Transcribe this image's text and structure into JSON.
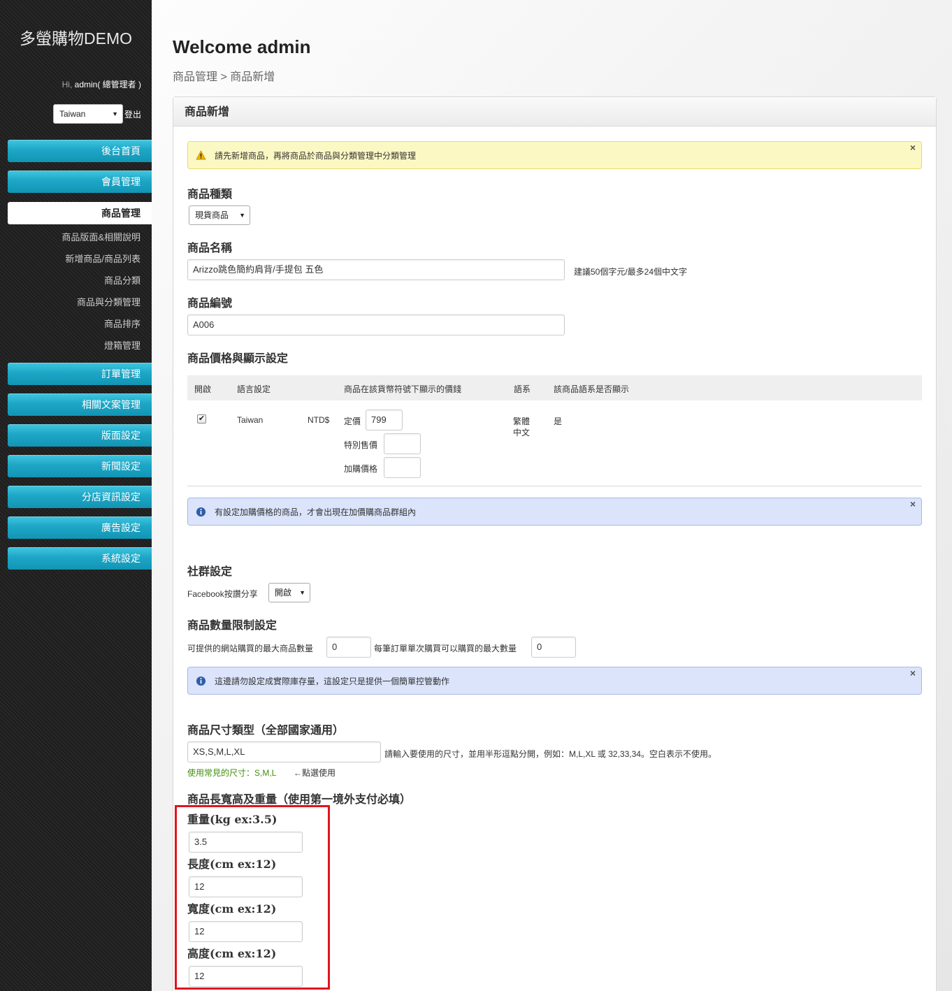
{
  "sidebar": {
    "brand": "多螢購物DEMO",
    "greeting_prefix": "Hi, ",
    "greeting_user": "admin( 總管理者 )",
    "language": "Taiwan",
    "logout": "登出",
    "nav": [
      {
        "label": "後台首頁"
      },
      {
        "label": "會員管理"
      },
      {
        "label": "商品管理"
      },
      {
        "label": "訂單管理"
      },
      {
        "label": "相關文案管理"
      },
      {
        "label": "版面設定"
      },
      {
        "label": "新聞設定"
      },
      {
        "label": "分店資訊設定"
      },
      {
        "label": "廣告設定"
      },
      {
        "label": "系統設定"
      }
    ],
    "sub_items": [
      {
        "label": "商品版面&相關說明"
      },
      {
        "label": "新增商品/商品列表"
      },
      {
        "label": "商品分類"
      },
      {
        "label": "商品與分類管理"
      },
      {
        "label": "商品排序"
      },
      {
        "label": "燈箱管理"
      }
    ]
  },
  "header": {
    "title": "Welcome admin",
    "breadcrumb": "商品管理 > 商品新增"
  },
  "panel": {
    "title": "商品新增",
    "warn_alert": "請先新增商品，再將商品於商品與分類管理中分類管理",
    "product_type_label": "商品種類",
    "product_type_value": "現貨商品",
    "product_name_label": "商品名稱",
    "product_name_value": "Arizzo跳色簡約肩背/手提包 五色",
    "product_name_hint": "建議50個字元/最多24個中文字",
    "product_code_label": "商品編號",
    "product_code_value": "A006",
    "price_section_label": "商品價格與顯示設定",
    "price_table": {
      "headers": [
        "開啟",
        "語言設定",
        "商品在該貨幣符號下顯示的價錢",
        "語系",
        "該商品語系是否顯示"
      ],
      "row": {
        "enabled": "✔",
        "language": "Taiwan",
        "currency": "NTD$",
        "list_price_label": "定價",
        "list_price_value": "799",
        "special_price_label": "特別售價",
        "special_price_value": "",
        "addon_price_label": "加購價格",
        "addon_price_value": "",
        "locale_line1": "繁體",
        "locale_line2": "中文",
        "visible": "是"
      }
    },
    "info_alert_1": "有設定加購價格的商品，才會出現在加價購商品群組內",
    "social_label": "社群設定",
    "facebook_label": "Facebook按讚分享",
    "facebook_value": "開啟",
    "quantity_label": "商品數量限制設定",
    "max_qty_label": "可提供的網站購買的最大商品數量",
    "max_qty_value": "0",
    "per_order_label": "每筆訂單單次購買可以購買的最大數量",
    "per_order_value": "0",
    "info_alert_2": "這邊請勿設定成實際庫存量，這設定只是提供一個簡單控管動作",
    "size_label": "商品尺寸類型（全部國家通用）",
    "size_value": "XS,S,M,L,XL",
    "size_hint": "請輸入要使用的尺寸，並用半形逗點分開，例如：M,L,XL 或 32,33,34。空白表示不使用。",
    "common_sizes_label": "使用常見的尺寸：S,M,L",
    "common_sizes_hint": "←點選使用",
    "dimensions_label": "商品長寬高及重量（使用第一境外支付必填）",
    "weight_label": "重量(kg ex:3.5)",
    "weight_value": "3.5",
    "length_label": "長度(cm ex:12)",
    "length_value": "12",
    "width_label": "寬度(cm ex:12)",
    "width_value": "12",
    "height_label": "高度(cm ex:12)",
    "height_value": "12"
  },
  "colors": {
    "nav_accent": "#1ea6c6",
    "highlight": "#e0141e",
    "warn_bg": "#fcf8c3",
    "info_bg": "#dbe4fb"
  }
}
